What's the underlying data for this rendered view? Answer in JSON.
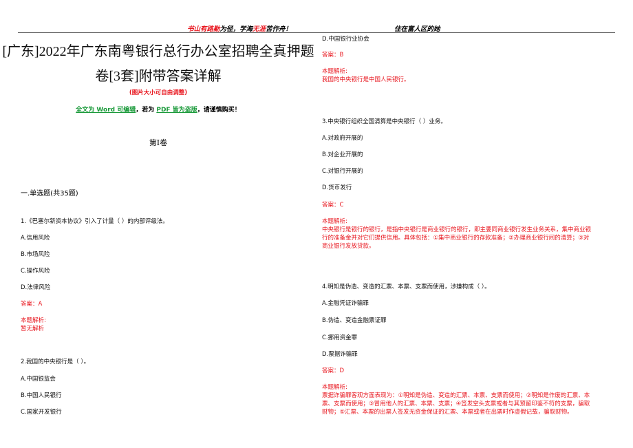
{
  "header": {
    "left_motto_a": "书山有路",
    "left_motto_b": "勤",
    "left_motto_c": "为径，学海",
    "left_motto_d": "无涯",
    "left_motto_e": "苦作舟！",
    "right_motto": "住在富人区的她"
  },
  "title": {
    "line1": "[广东]2022年广东南粤银行总行办公室招聘全真押题",
    "line2": "卷[3套]附带答案详解",
    "note": "(图片大小可自由调整)",
    "notice_a": "全文为 Word 可编辑",
    "notice_b": "，若为",
    "notice_c": "PDF 皆为盗版",
    "notice_d": "，请谨慎购买！"
  },
  "volume": "第Ⅰ卷",
  "section": "一.单选题(共35题)",
  "left": {
    "q1": {
      "q": "1.《巴塞尔新资本协议》引入了计量（ ）的内部评级法。",
      "opts": [
        "A.信用风险",
        "B.市场风险",
        "C.操作风险",
        "D.法律风险"
      ],
      "answer": "答案：A",
      "analysis_label": "本题解析:",
      "analysis": "暂无解析"
    },
    "q2": {
      "q": "2.我国的中央银行是（ ）。",
      "opts": [
        "A.中国银监会",
        "B.中国人民银行",
        "C.国家开发银行"
      ]
    }
  },
  "right": {
    "q2_rest": {
      "opt": "D.中国银行业协会",
      "answer": "答案：B",
      "analysis_label": "本题解析:",
      "analysis": "我国的中央银行是中国人民银行。"
    },
    "q3": {
      "q": "3.中央银行组织全国清算是中央银行（ ）业务。",
      "opts": [
        "A.对政府开展的",
        "B.对企业开展的",
        "C.对银行开展的",
        "D.货币发行"
      ],
      "answer": "答案：C",
      "analysis_label": "本题解析:",
      "analysis": [
        "中央银行是银行的银行，是指中央银行是商业银行的银行，即主要同商业银行发生业务关系，集中商业银",
        "行的准备金并对它们提供信用。具体包括：①集中商业银行的存款准备；②办理商业银行间的清算；③对",
        "商业银行发放贷款。"
      ]
    },
    "q4": {
      "q": "4.明知是伪造、变造的汇票、本票、支票而使用，涉嫌构成（ ）。",
      "opts": [
        "A.金融凭证诈骗罪",
        "B.伪造、变造金融票证罪",
        "C.挪用资金罪",
        "D.票据诈骗罪"
      ],
      "answer": "答案：D",
      "analysis_label": "本题解析:",
      "analysis": [
        "票据诈骗罪客观方面表现为：①明知是伪造、变造的汇票、本票、支票而使用；②明知是作废的汇票、本",
        "票、支票而使用；③冒用他人的汇票、本票、支票；④签发空头支票或者与其预留印鉴不符的支票，骗取",
        "财物；⑤汇票、本票的出票人签发无资金保证的汇票、本票或者在出票时作虚假记载，骗取财物。"
      ]
    }
  }
}
